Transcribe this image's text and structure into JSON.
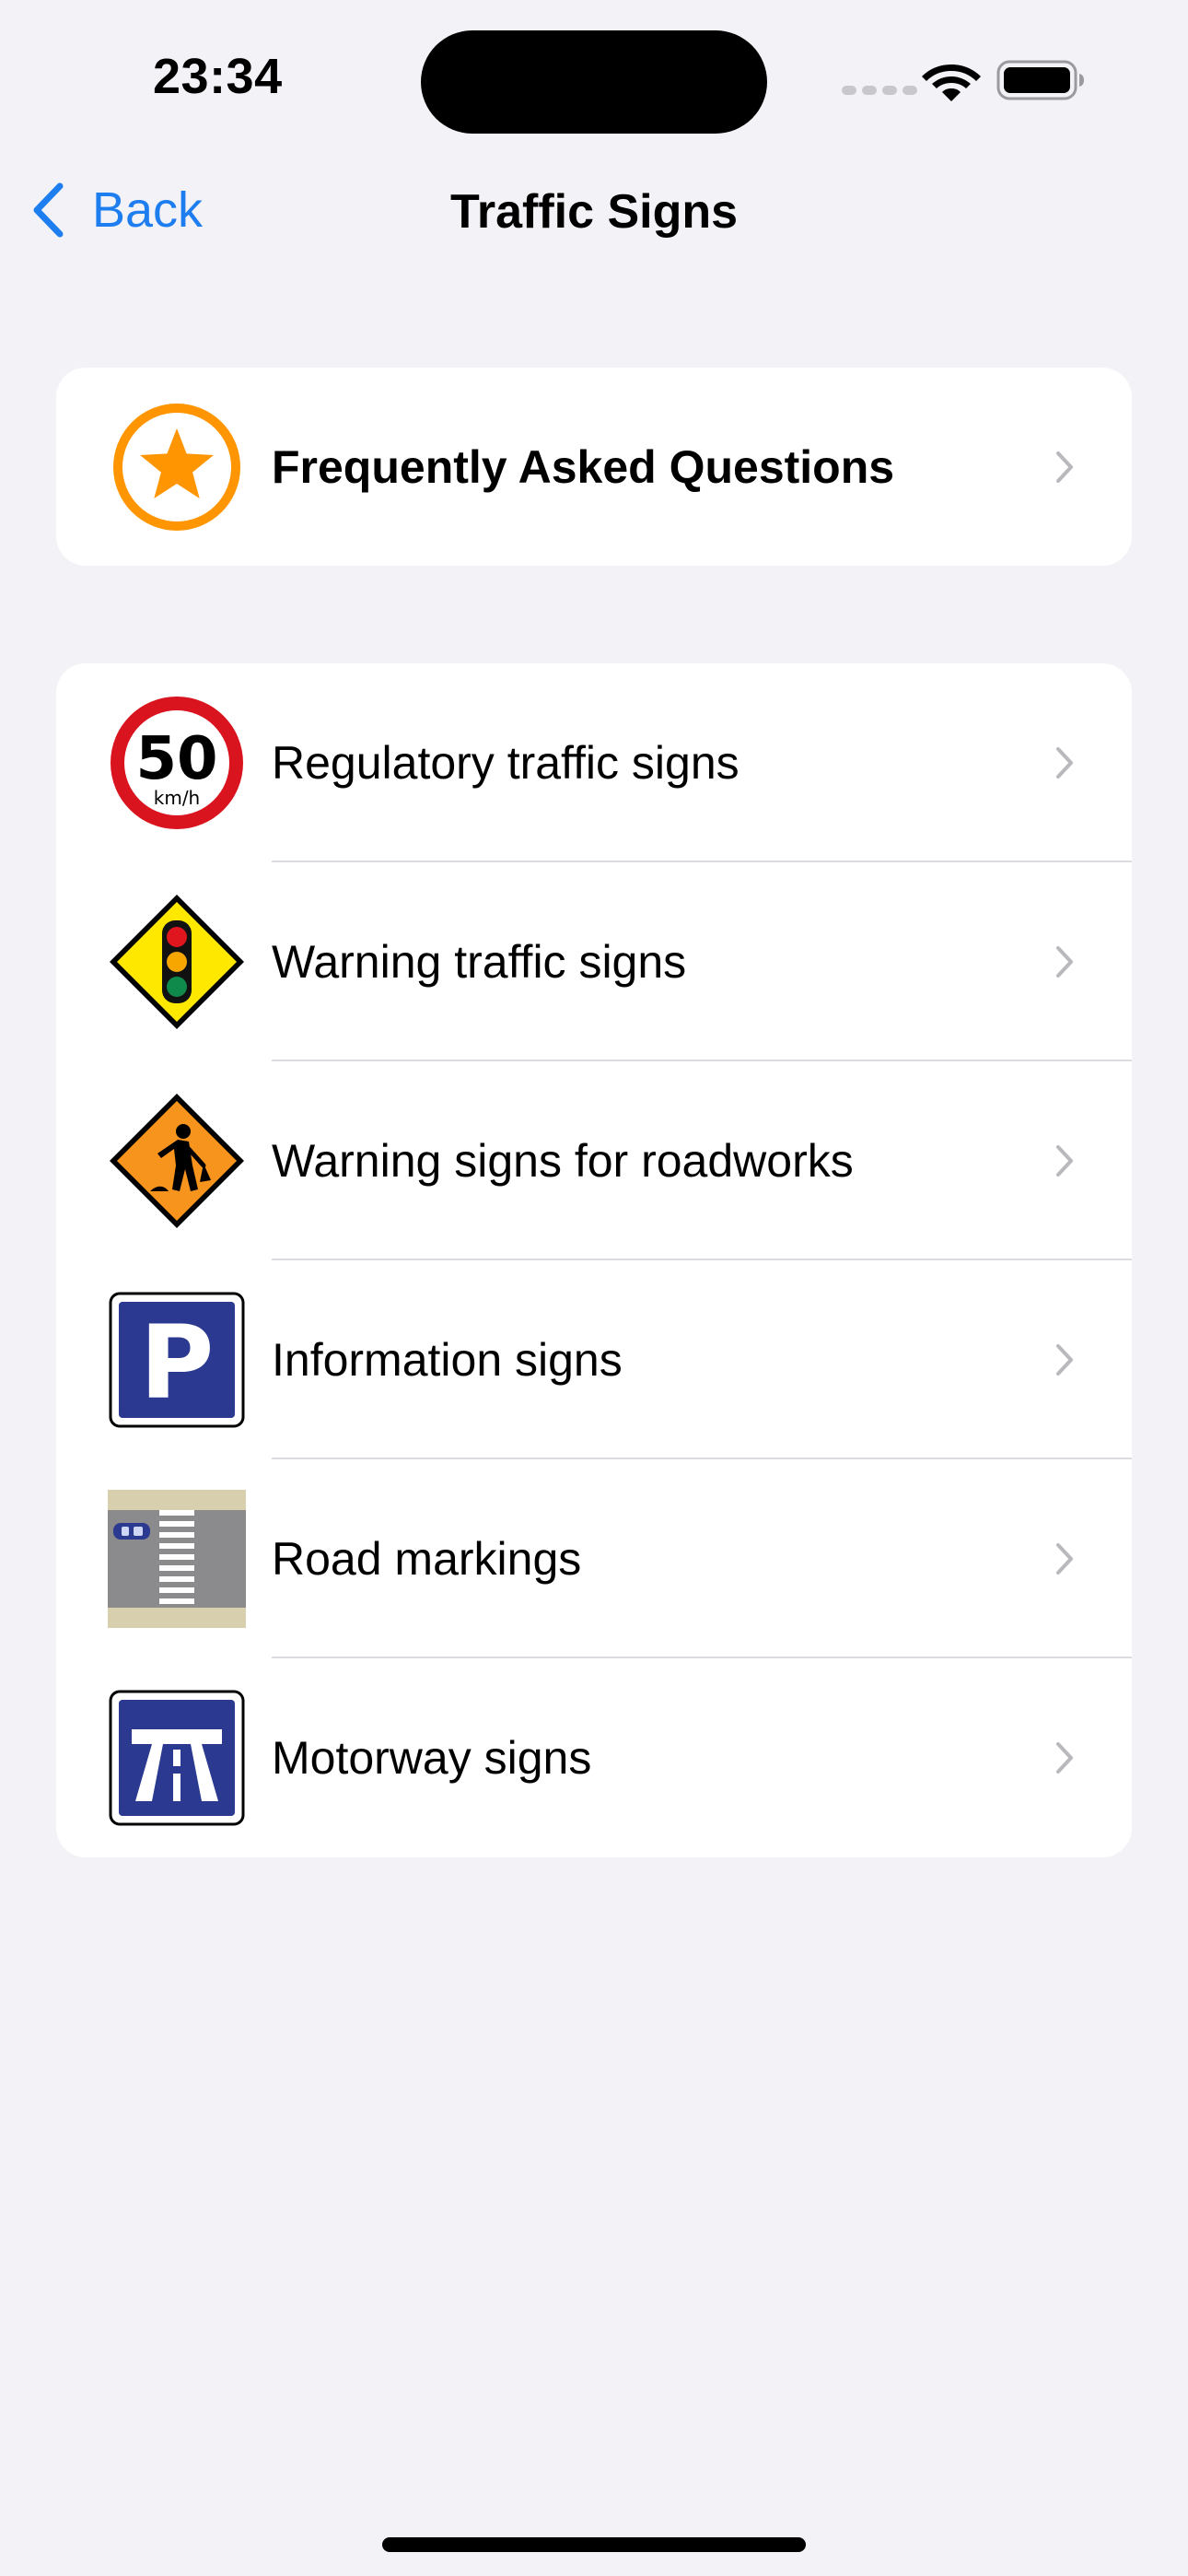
{
  "status_bar": {
    "time": "23:34",
    "icons": [
      "cellular-signal-icon",
      "wifi-icon",
      "battery-icon"
    ]
  },
  "nav": {
    "back_label": "Back",
    "title": "Traffic Signs"
  },
  "faq": {
    "label": "Frequently Asked Questions",
    "icon": "star-icon"
  },
  "categories": [
    {
      "label": "Regulatory traffic signs",
      "icon": "speed-limit-icon",
      "sign_text": "50",
      "sign_unit": "km/h"
    },
    {
      "label": "Warning traffic signs",
      "icon": "traffic-light-warning-icon"
    },
    {
      "label": "Warning signs for roadworks",
      "icon": "roadworks-icon"
    },
    {
      "label": "Information signs",
      "icon": "parking-sign-icon",
      "sign_text": "P"
    },
    {
      "label": "Road markings",
      "icon": "road-markings-icon"
    },
    {
      "label": "Motorway signs",
      "icon": "motorway-sign-icon"
    }
  ],
  "colors": {
    "accent": "#1e7ef0",
    "background": "#f2f2f7",
    "card": "#ffffff",
    "star_orange": "#ff9500",
    "sign_red": "#d9141e",
    "sign_blue": "#2b3990",
    "warning_yellow": "#ffe800",
    "roadworks_orange": "#f7941d"
  }
}
